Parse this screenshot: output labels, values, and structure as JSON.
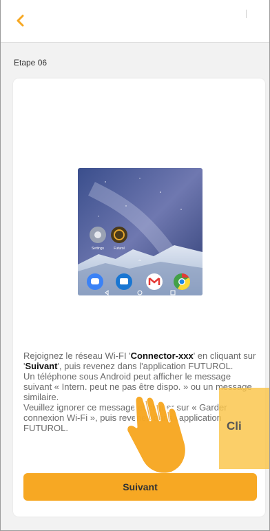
{
  "header": {
    "back_icon": "chevron-left-icon",
    "accent_color": "#f7a823"
  },
  "step": {
    "label": "Etape 06"
  },
  "illustration": {
    "icons": [
      "settings-app-icon",
      "futurol-app-icon",
      "messages-app-icon",
      "sms-app-icon",
      "gmail-app-icon",
      "chrome-app-icon",
      "nav-back-icon",
      "nav-home-icon",
      "nav-recents-icon"
    ],
    "app_labels": [
      "Settings",
      "Futurol"
    ]
  },
  "instructions": {
    "l1a": "Rejoignez le réseau Wi-FI '",
    "l1b": "Connector-xxx",
    "l1c": "' en cliquant sur '",
    "l1d": "Suivant",
    "l1e": "', puis revenez dans l'application FUTUROL.",
    "l2": "Un téléphone sous Android peut afficher le message suivant « Intern. peut ne pas être dispo. » ou un message similaire.",
    "l3": "Veuillez ignorer ce message et cliquer sur « Garder connexion Wi-Fi », puis revenez dans l'application FUTUROL."
  },
  "actions": {
    "next_label": "Suivant"
  },
  "tooltip": {
    "text": "Cli",
    "icon": "tap-hand-icon"
  }
}
